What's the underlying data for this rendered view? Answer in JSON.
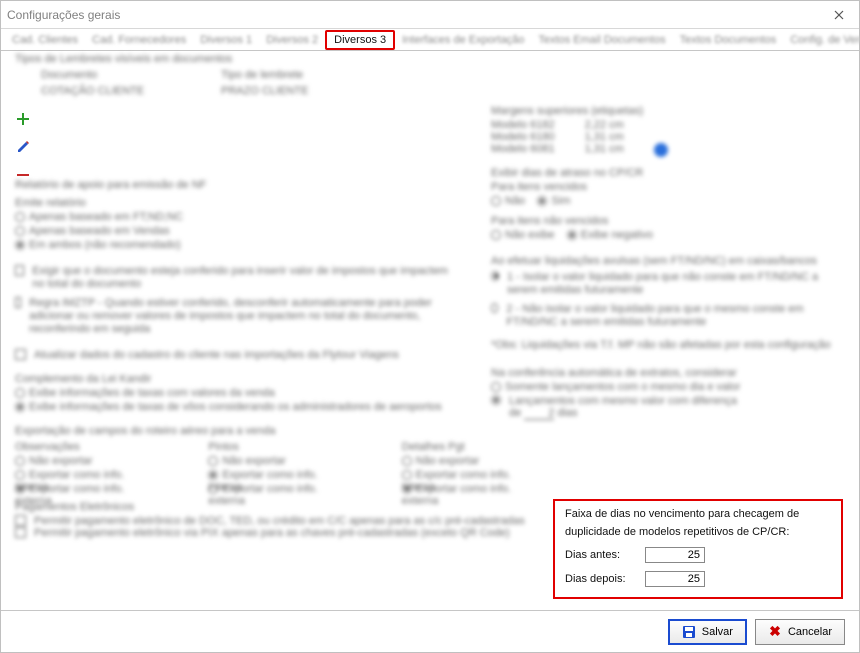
{
  "window": {
    "title": "Configurações gerais"
  },
  "tabs": {
    "items": [
      {
        "label": "Cad. Clientes"
      },
      {
        "label": "Cad. Fornecedores"
      },
      {
        "label": "Diversos 1"
      },
      {
        "label": "Diversos 2"
      },
      {
        "label": "Diversos 3"
      },
      {
        "label": "Interfaces de Exportação"
      },
      {
        "label": "Textos Email Documentos"
      },
      {
        "label": "Textos Documentos"
      },
      {
        "label": "Config. de Vendas"
      }
    ],
    "active_index": 4
  },
  "left": {
    "lembretes_title": "Tipos de Lembretes visíveis em documentos",
    "col_doc": "Documento",
    "col_tipo": "Tipo de lembrete",
    "row_doc": "COTAÇÃO CLIENTE",
    "row_tipo": "PRAZO CLIENTE",
    "relatorio_title": "Relatório de apoio para emissão de NF",
    "emite_label": "Emite relatório",
    "r_op1": "Apenas baseado em FT;ND;NC",
    "r_op2": "Apenas baseado em Vendas",
    "r_op3": "Em ambos (não recomendado)",
    "exigir_label": "Exigir que o documento esteja conferido para inserir valor de impostos que impactem no total do documento",
    "regra_label": "Regra IMZTP - Quando estiver conferido, desconferir automaticamente para poder adicionar ou remover valores de impostos que impactem no total do documento, reconferindo em seguida",
    "atualizar_label": "Atualizar dados do cadastro do cliente nas importações da Flytour Viagens",
    "complemento_title": "Complemento da Lei Kandir",
    "comp_op1": "Exibe informações de taxas com valores da venda",
    "comp_op2": "Exibe informações de taxas de vôos considerando os administradores de aeroportos",
    "export_title": "Exportação de campos do roteiro aéreo para a venda",
    "obs_title": "Observações",
    "pintos_title": "Pintos",
    "detalhes_title": "Detalhes Pgt",
    "ex_nao": "Não exportar",
    "ex_int": "Exportar como info. interna",
    "ex_ext": "Exportar como info. externa",
    "pag_title": "Pagamentos Eletrônicos",
    "pag_op1": "Permitir pagamento eletrônico de DOC, TED, ou crédito em C/C apenas para as c/c pré-cadastradas",
    "pag_op2": "Permitir pagamento eletrônico via PIX apenas para as chaves pré-cadastradas (exceto QR Code)"
  },
  "right": {
    "margens_title": "Margens superiores (etiquetas)",
    "m1_lbl": "Modelo 6182",
    "m1_val": "2,22 cm",
    "m2_lbl": "Modelo 6180",
    "m2_val": "1,31 cm",
    "m3_lbl": "Modelo 6081",
    "m3_val": "1,31 cm",
    "exibir_title": "Exibir dias de atraso no CP/CR",
    "venc_title": "Para itens vencidos",
    "venc_nao": "Não",
    "venc_sim": "Sim",
    "nvenc_title": "Para itens não vencidos",
    "nvenc_nao": "Não exibe",
    "nvenc_neg": "Exibe negativo",
    "liq_title": "Ao efetuar liquidações avulsas (sem FT/ND/NC) em caixas/bancos",
    "liq_op1": "1 - Isolar o valor liquidado para que não conste em FT/ND/NC a serem emitidas futuramente",
    "liq_op2": "2 - Não isolar o valor liquidado para que o mesmo conste em FT/ND/NC a serem emitidas futuramente",
    "obs_liq": "*Obs: Liquidações via T.f. MP não são afetadas por esta configuração",
    "conf_title": "Na conferência automática de extratos, considerar",
    "conf_op1": "Somente lançamentos com o mesmo dia e valor",
    "conf_op2_a": "Lançamentos com mesmo valor com diferença",
    "conf_op2_b": "de",
    "conf_op2_c": "dias",
    "conf_dias_val": "2"
  },
  "highlight": {
    "title1": "Faixa de dias no vencimento para checagem de",
    "title2": "duplicidade de modelos repetitivos de CP/CR:",
    "dias_antes_label": "Dias antes:",
    "dias_antes_value": "25",
    "dias_depois_label": "Dias depois:",
    "dias_depois_value": "25"
  },
  "buttons": {
    "save": "Salvar",
    "cancel": "Cancelar"
  }
}
